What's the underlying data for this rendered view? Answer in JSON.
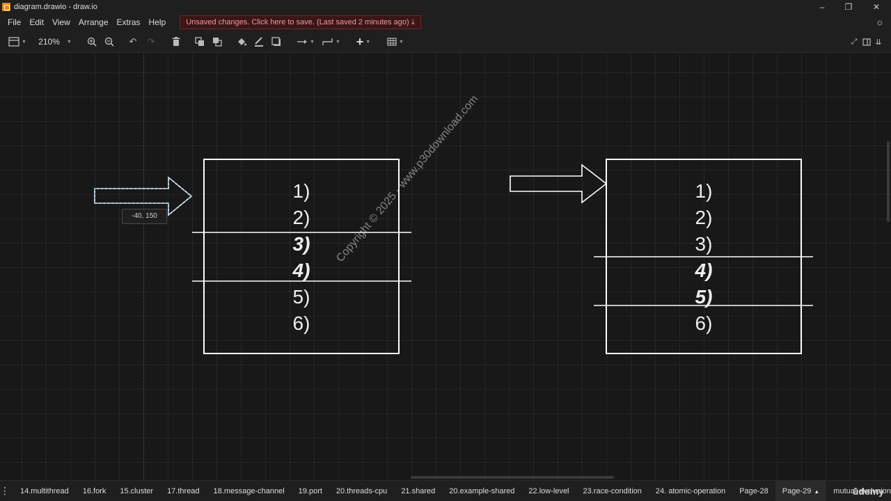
{
  "window": {
    "title": "diagram.drawio - draw.io",
    "min_icon": "minimize-icon",
    "max_icon": "restore-icon",
    "close_icon": "close-icon"
  },
  "menu": {
    "items": [
      "File",
      "Edit",
      "View",
      "Arrange",
      "Extras",
      "Help"
    ]
  },
  "banner": {
    "text": "Unsaved changes. Click here to save. (Last saved 2 minutes ago)",
    "icon": "download-icon",
    "color": "#f29a9a"
  },
  "toolbar": {
    "zoom": "210%",
    "icons": [
      "sidebar-toggle-icon",
      "zoom-in-icon",
      "zoom-out-icon",
      "undo-icon",
      "redo-icon",
      "delete-icon",
      "to-front-icon",
      "to-back-icon",
      "fill-color-icon",
      "line-color-icon",
      "shadow-icon",
      "connection-icon",
      "waypoints-icon",
      "insert-icon",
      "table-icon",
      "fullscreen-icon",
      "format-panel-icon",
      "collapse-icon"
    ]
  },
  "canvas": {
    "tooltip": "-40, 150",
    "left_stack": {
      "items": [
        "1)",
        "2)",
        "3)",
        "4)",
        "5)",
        "6)"
      ],
      "critical": [
        "3)",
        "4)"
      ]
    },
    "right_stack": {
      "items": [
        "1)",
        "2)",
        "3)",
        "4)",
        "5)",
        "6)"
      ],
      "critical": [
        "4)",
        "5)"
      ]
    },
    "watermark": "Copyright © 2025 - www.p30download.com"
  },
  "tabs": {
    "pages": [
      "14.multithread",
      "16.fork",
      "15.cluster",
      "17.thread",
      "18.message-channel",
      "19.port",
      "20.threads-cpu",
      "21.shared",
      "20.example-shared",
      "22.low-level",
      "23.race-condition",
      "24. atomic-operation",
      "Page-28",
      "Page-29",
      "mutual-exclusion"
    ],
    "active": "Page-29",
    "logo": "udemy"
  },
  "colors": {
    "accent": "#f08705",
    "canvas_bg": "#181818",
    "stroke": "#ffffff",
    "selection": "#6cb4e4"
  }
}
